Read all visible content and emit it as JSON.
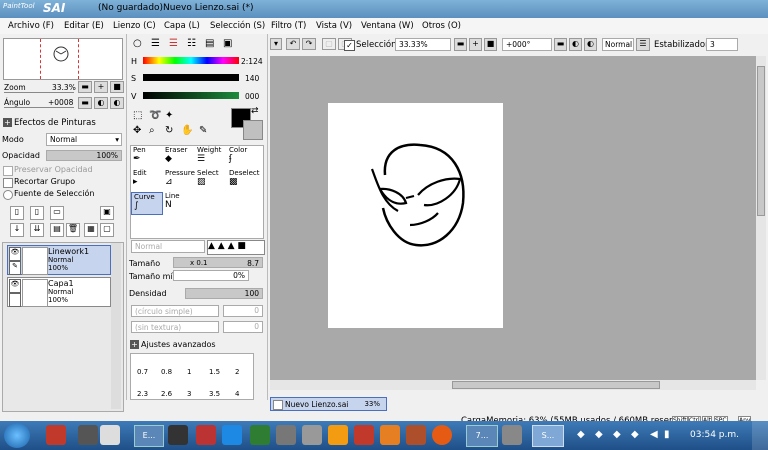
{
  "app": {
    "logo_top": "PaintTool",
    "logo_main": "SAI",
    "title": "(No guardado)Nuevo Lienzo.sai (*)"
  },
  "menu": [
    "Archivo (F)",
    "Editar (E)",
    "Lienzo (C)",
    "Capa (L)",
    "Selección (S)",
    "Filtro (T)",
    "Vista (V)",
    "Ventana (W)",
    "Otros (O)"
  ],
  "navigator": {
    "zoom_label": "Zoom",
    "zoom_value": "33.3%",
    "angle_label": "Ángulo",
    "angle_value": "+0008"
  },
  "layer_panel": {
    "effects_label": "Efectos de Pinturas",
    "mode_label": "Modo",
    "mode_value": "Normal",
    "opacity_label": "Opacidad",
    "opacity_value": "100%",
    "opacity_level": 1.0,
    "preserve_opacity": "Preservar Opacidad",
    "clip_group": "Recortar Grupo",
    "selection_source": "Fuente de Selección",
    "layers": [
      {
        "name": "Linework1",
        "mode": "Normal",
        "opacity": "100%"
      },
      {
        "name": "Capa1",
        "mode": "Normal",
        "opacity": "100%"
      }
    ]
  },
  "colors": {
    "h_label": "H",
    "h_value": "2:124",
    "s_label": "S",
    "s_value": "140",
    "v_label": "V",
    "v_value": "000",
    "primary": "#000000",
    "secondary": "#c0c0c0"
  },
  "tool_grid": [
    {
      "label": "Pen",
      "icon": "pen-icon"
    },
    {
      "label": "Eraser",
      "icon": "eraser-icon"
    },
    {
      "label": "Weight",
      "icon": "weight-icon"
    },
    {
      "label": "Color",
      "icon": "color-icon"
    },
    {
      "label": "Edit",
      "icon": "edit-icon"
    },
    {
      "label": "Pressure",
      "icon": "pressure-icon"
    },
    {
      "label": "Select",
      "icon": "select-icon"
    },
    {
      "label": "Deselect",
      "icon": "deselect-icon"
    },
    {
      "label": "Curve",
      "icon": "curve-icon"
    },
    {
      "label": "Line",
      "icon": "line-icon"
    }
  ],
  "brush": {
    "mode_value": "Normal",
    "size_label": "Tamaño",
    "size_mult": "x 0.1",
    "size_value": "8.7",
    "size_level": 0.87,
    "min_size_label": "Tamaño mín.",
    "min_size_value": "0%",
    "density_label": "Densidad",
    "density_value": "100",
    "density_level": 1.0,
    "shape_value": "(círculo simple)",
    "shape_num": "0",
    "texture_value": "(sin textura)",
    "texture_num": "0",
    "advanced_label": "Ajustes avanzados",
    "brush_sizes_row1": [
      "0.7",
      "0.8",
      "1",
      "1.5",
      "2"
    ],
    "brush_sizes_row2": [
      "2.3",
      "2.6",
      "3",
      "3.5",
      "4"
    ]
  },
  "canvas_toolbar": {
    "selection_label": "Selección",
    "zoom_value": "33.33%",
    "rotation_value": "+000°",
    "blend_mode": "Normal",
    "stabilizer_label": "Estabilizador",
    "stabilizer_value": "3"
  },
  "canvas_tab": {
    "name": "Nuevo Lienzo.sai",
    "zoom": "33%"
  },
  "status": {
    "memory": "CargaMemoria: 63% (55MB usados / 660MB reservados)",
    "keys": [
      "Shift",
      "Ctrl",
      "Alt",
      "SPC",
      "Any"
    ]
  },
  "taskbar": {
    "time": "03:54 p.m.",
    "apps": [
      "E...",
      "7...",
      "S..."
    ]
  }
}
